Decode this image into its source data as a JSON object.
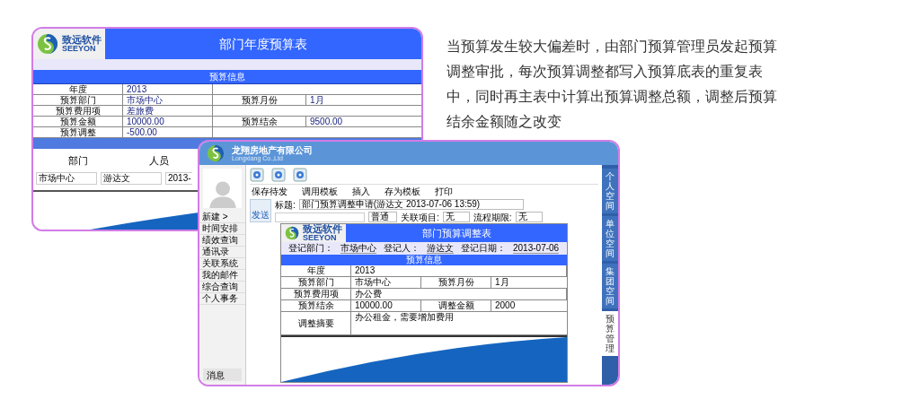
{
  "intro_text": "当预算发生较大偏差时，由部门预算管理员发起预算调整审批，每次预算调整都写入预算底表的重复表中，同时再主表中计算出预算调整总额，调整后预算结余金额随之改变",
  "annual_form": {
    "logo": {
      "name": "致远软件",
      "latin": "SEEYON"
    },
    "title": "部门年度预算表",
    "section": "预算信息",
    "rows": [
      {
        "label": "年度",
        "value": "2013"
      },
      {
        "label": "预算部门",
        "value": "市场中心",
        "label_2": "预算月份",
        "value_2": "1月"
      },
      {
        "label": "预算费用项",
        "value": "差旅费"
      },
      {
        "label": "预算金额",
        "value": "10000.00",
        "label_2": "预算结余",
        "value_2": "9500.00"
      },
      {
        "label": "预算调整",
        "value": "-500.00"
      }
    ],
    "columns": [
      "部门",
      "人员"
    ],
    "entry": [
      "市场中心",
      "游达文",
      "2013-"
    ]
  },
  "oa_window": {
    "company": "龙翔房地产有限公司",
    "company_en": "Longxiang Co.,Ltd",
    "sidebar": [
      {
        "label": "新建 >"
      },
      {
        "label": "时间安排"
      },
      {
        "label": "绩效查询"
      },
      {
        "label": "通讯录"
      },
      {
        "label": "关联系统"
      },
      {
        "label": "我的邮件"
      },
      {
        "label": "综合查询"
      },
      {
        "label": "个人事务"
      }
    ],
    "message": "消息",
    "actions": [
      "保存待发",
      "调用模板",
      "插入",
      "存为模板",
      "打印"
    ],
    "send": "发送",
    "subject_label": "标题:",
    "subject": "部门预算调整申请(游达文 2013-07-06 13:59)",
    "priority": "普通",
    "fields": [
      {
        "label": "关联项目:",
        "value": "无"
      },
      {
        "label": "流程期限:",
        "value": "无"
      }
    ],
    "form": {
      "logo": {
        "name": "致远软件",
        "latin": "SEEYON"
      },
      "title": "部门预算调整表",
      "meta": [
        {
          "label": "登记部门：",
          "value": "市场中心"
        },
        {
          "label": "登记人：",
          "value": "游达文"
        },
        {
          "label": "登记日期：",
          "value": "2013-07-06"
        }
      ],
      "section": "预算信息",
      "rows": [
        {
          "kind": "pair",
          "label": "年度",
          "value": "2013"
        },
        {
          "kind": "pair",
          "label": "预算部门",
          "value": "市场中心",
          "label_2": "预算月份",
          "value_2": "1月"
        },
        {
          "kind": "pair",
          "label": "预算费用项",
          "value": "办公费"
        },
        {
          "kind": "pair",
          "label": "预算结余",
          "value": "10000.00",
          "label_2": "调整金额",
          "value_2": "2000"
        },
        {
          "kind": "summary",
          "label": "调整摘要",
          "value": "办公租金，需要增加费用"
        }
      ]
    },
    "side_tabs": [
      {
        "label": "个人空间",
        "selected": false
      },
      {
        "label": "单位空间",
        "selected": false
      },
      {
        "label": "集团空间",
        "selected": false
      },
      {
        "label": "预算管理",
        "selected": true
      }
    ]
  }
}
